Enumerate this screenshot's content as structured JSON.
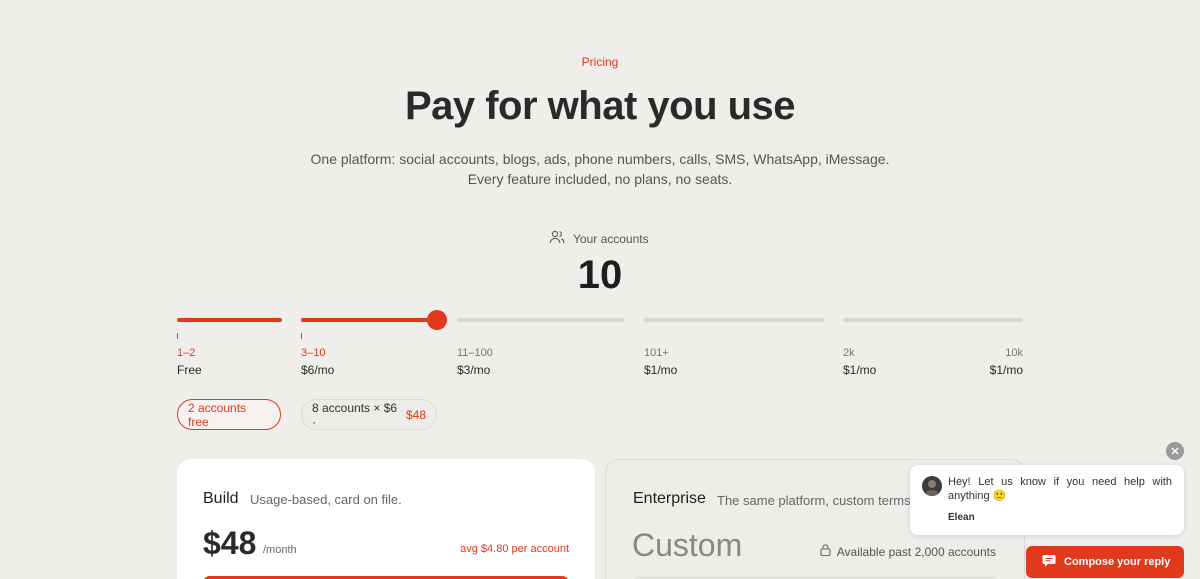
{
  "eyebrow": "Pricing",
  "headline": "Pay for what you use",
  "subline1": "One platform: social accounts, blogs, ads, phone numbers, calls, SMS, WhatsApp, iMessage.",
  "subline2": "Every feature included, no plans, no seats.",
  "accounts": {
    "label": "Your accounts",
    "value": "10",
    "icon": "users-icon",
    "slider_value": 10
  },
  "tiers": [
    {
      "range": "1–2",
      "price": "Free",
      "active": true
    },
    {
      "range": "3–10",
      "price": "$6/mo",
      "active": true
    },
    {
      "range": "11–100",
      "price": "$3/mo",
      "active": false
    },
    {
      "range": "101+",
      "price": "$1/mo",
      "active": false
    },
    {
      "range": "2k",
      "price": "$1/mo",
      "active": false
    },
    {
      "range": "10k",
      "price": "$1/mo",
      "active": false
    }
  ],
  "breakdown": {
    "free_label": "2 accounts free",
    "calc_label": "8 accounts × $6 ·",
    "calc_total": "$48"
  },
  "build": {
    "title": "Build",
    "desc": "Usage-based, card on file.",
    "price": "$48",
    "period": "/month",
    "avg": "avg $4.80 per account"
  },
  "enterprise": {
    "title": "Enterprise",
    "desc": "The same platform, custom terms.",
    "price": "Custom",
    "note": "Available past 2,000 accounts",
    "icon": "lock-icon"
  },
  "chat": {
    "message": "Hey! Let us know if you need help with anything 🙂",
    "agent": "Elean",
    "compose_label": "Compose your reply"
  },
  "colors": {
    "accent": "#e0391c",
    "background": "#f0eeeb"
  }
}
